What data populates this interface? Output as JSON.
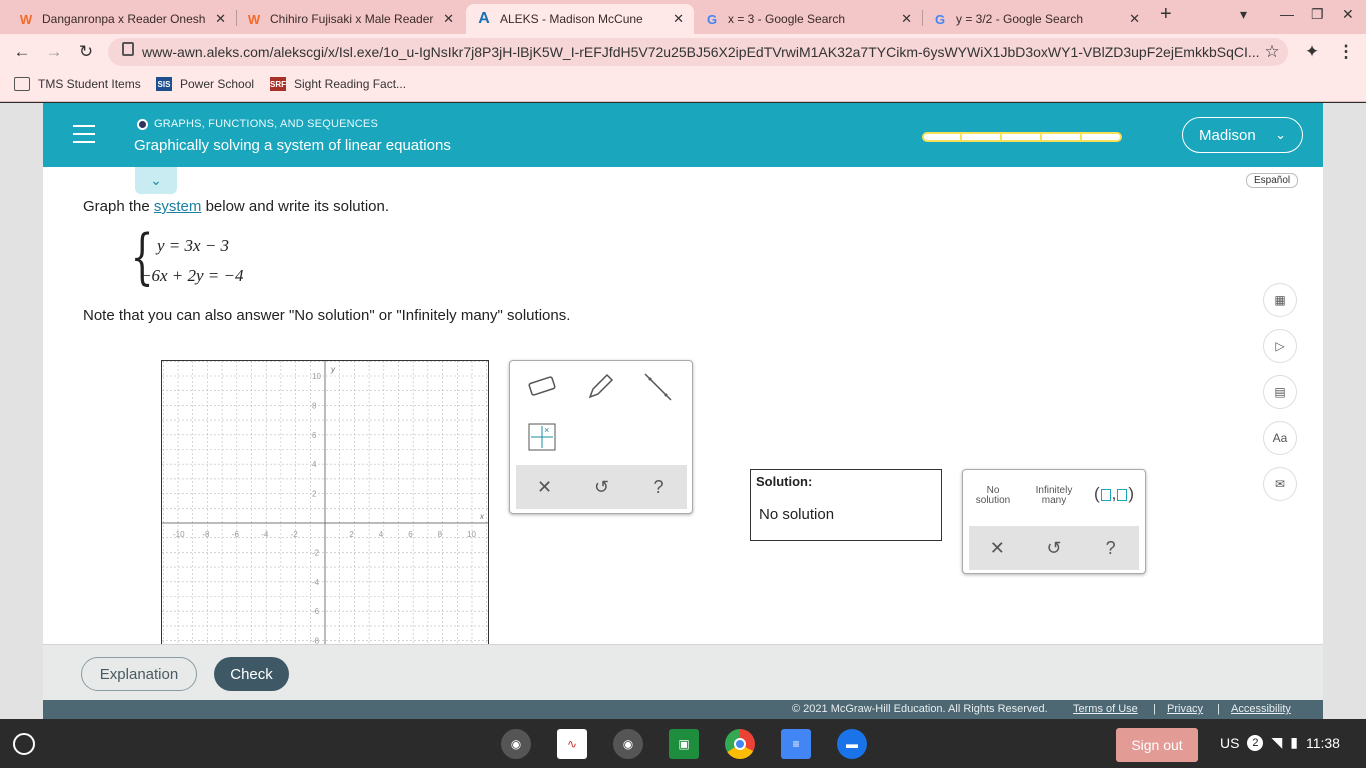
{
  "browser": {
    "tabs": [
      {
        "title": "Danganronpa x Reader Onesh",
        "icon": "wattpad-icon",
        "active": false
      },
      {
        "title": "Chihiro Fujisaki x Male Reader",
        "icon": "wattpad-icon",
        "active": false
      },
      {
        "title": "ALEKS - Madison McCune",
        "icon": "aleks-icon",
        "active": true
      },
      {
        "title": "x = 3 - Google Search",
        "icon": "google-icon",
        "active": false
      },
      {
        "title": "y = 3/2 - Google Search",
        "icon": "google-icon",
        "active": false
      }
    ],
    "url": "www-awn.aleks.com/alekscgi/x/Isl.exe/1o_u-IgNsIkr7j8P3jH-lBjK5W_I-rEFJfdH5V72u25BJ56X2ipEdTVrwiM1AK32a7TYCikm-6ysWYWiX1JbD3oxWY1-VBlZD3upF2ejEmkkbSqCI...",
    "bookmarks": [
      {
        "label": "TMS Student Items",
        "icon": "folder-icon"
      },
      {
        "label": "Power School",
        "icon": "powerschool-icon",
        "badge": "SIS"
      },
      {
        "label": "Sight Reading Fact...",
        "icon": "srf-icon",
        "badge": "SRF"
      }
    ]
  },
  "header": {
    "topic": "GRAPHS, FUNCTIONS, AND SEQUENCES",
    "lesson": "Graphically solving a system of linear equations",
    "progress": 1.0,
    "user": "Madison"
  },
  "language": "Español",
  "problem": {
    "prompt_before": "Graph the ",
    "prompt_link": "system",
    "prompt_after": " below and write its solution.",
    "eq1": "y = 3x − 3",
    "eq2": "−6x + 2y = −4",
    "note": "Note that you can also answer \"No solution\" or \"Infinitely many\" solutions."
  },
  "graph": {
    "x_ticks": [
      "-10",
      "-8",
      "-6",
      "-4",
      "-2",
      "2",
      "4",
      "6",
      "8",
      "10"
    ],
    "y_ticks": [
      "10",
      "8",
      "6",
      "4",
      "2",
      "-2",
      "-4",
      "-6",
      "-8"
    ],
    "x_label": "x",
    "y_label": "y"
  },
  "answer": {
    "label": "Solution:",
    "value": "No solution",
    "options": {
      "no_solution": "No solution",
      "infinitely_many": "Infinitely many"
    }
  },
  "footer": {
    "explanation": "Explanation",
    "check": "Check",
    "copyright": "© 2021 McGraw-Hill Education. All Rights Reserved.",
    "links": [
      "Terms of Use",
      "Privacy",
      "Accessibility"
    ]
  },
  "shelf": {
    "signout": "Sign out",
    "locale": "US",
    "notifications": "2",
    "time": "11:38"
  }
}
